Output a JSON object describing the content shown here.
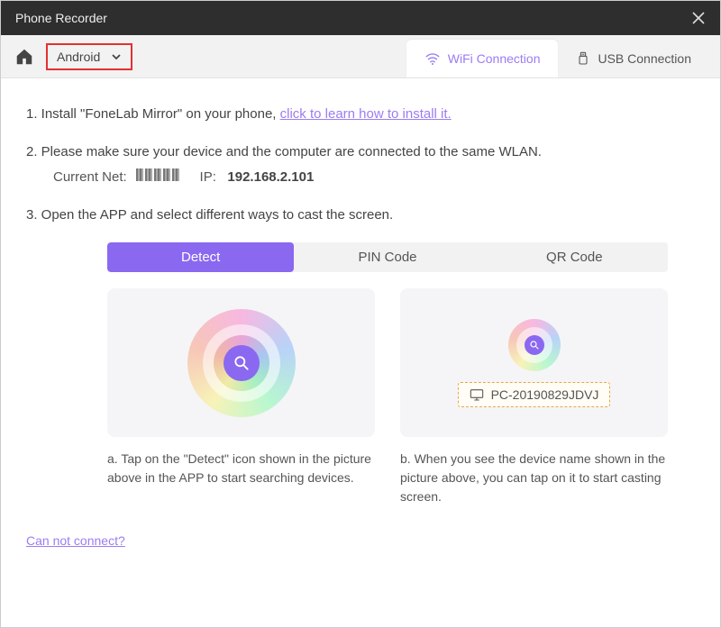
{
  "titlebar": {
    "title": "Phone Recorder"
  },
  "toolbar": {
    "device_selected": "Android",
    "tabs": {
      "wifi": "WiFi Connection",
      "usb": "USB Connection"
    }
  },
  "steps": {
    "s1_prefix": "1. Install \"FoneLab Mirror\" on your phone, ",
    "s1_link": "click to learn how to install it.",
    "s2": "2. Please make sure your device and the computer are connected to the same WLAN.",
    "net_label": "Current Net:",
    "ip_label": "IP:",
    "ip_value": "192.168.2.101",
    "s3": "3. Open the APP and select different ways to cast the screen."
  },
  "cast_tabs": {
    "detect": "Detect",
    "pin": "PIN Code",
    "qr": "QR Code"
  },
  "cards": {
    "device_name": "PC-20190829JDVJ",
    "caption_a": "a. Tap on the \"Detect\" icon shown in the picture above in the APP to start searching devices.",
    "caption_b": "b. When you see the device name shown in the picture above, you can tap on it to start casting screen."
  },
  "footer": {
    "cannot_connect": "Can not connect?"
  }
}
